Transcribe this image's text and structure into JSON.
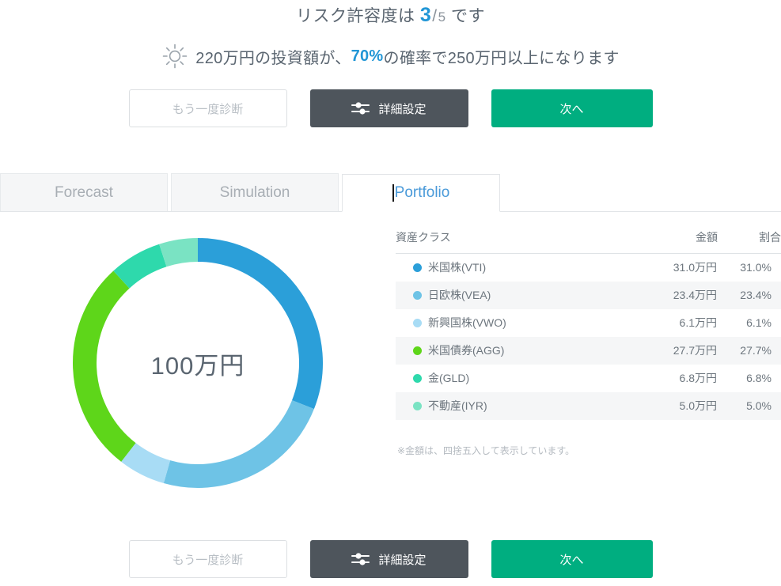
{
  "header": {
    "risk_prefix": "リスク許容度は",
    "risk_level": "3",
    "risk_slash": "/",
    "risk_max": "5",
    "risk_suffix": "です",
    "forecast_part1": "220万円の投資額が、",
    "forecast_probability": "70%",
    "forecast_part2": "の確率で250万円以上になります",
    "sun_icon": "sun-icon"
  },
  "actions": {
    "rediagnose_label": "もう一度診断",
    "settings_label": "詳細設定",
    "settings_icon": "sliders-icon",
    "next_label": "次へ"
  },
  "tabs": [
    {
      "label": "Forecast",
      "active": false
    },
    {
      "label": "Simulation",
      "active": false
    },
    {
      "label": "Portfolio",
      "active": true
    }
  ],
  "portfolio": {
    "center_total": "100万円",
    "note": "※金額は、四捨五入して表示しています。",
    "columns": {
      "asset_class": "資産クラス",
      "amount": "金額",
      "ratio": "割合"
    },
    "rows": [
      {
        "name": "米国株(VTI)",
        "amount": "31.0万円",
        "ratio": "31.0%",
        "color": "#2b9fd9"
      },
      {
        "name": "日欧株(VEA)",
        "amount": "23.4万円",
        "ratio": "23.4%",
        "color": "#6ec3e6"
      },
      {
        "name": "新興国株(VWO)",
        "amount": "6.1万円",
        "ratio": "6.1%",
        "color": "#a8dcf5"
      },
      {
        "name": "米国債券(AGG)",
        "amount": "27.7万円",
        "ratio": "27.7%",
        "color": "#5ed61a"
      },
      {
        "name": "金(GLD)",
        "amount": "6.8万円",
        "ratio": "6.8%",
        "color": "#2ed9ac"
      },
      {
        "name": "不動産(IYR)",
        "amount": "5.0万円",
        "ratio": "5.0%",
        "color": "#7ae3c3"
      }
    ]
  },
  "chart_data": {
    "type": "pie",
    "title": "Portfolio allocation",
    "center_label": "100万円",
    "unit": "%",
    "start_angle": 0,
    "donut_hole_ratio": 0.84,
    "categories": [
      "米国株(VTI)",
      "日欧株(VEA)",
      "新興国株(VWO)",
      "米国債券(AGG)",
      "金(GLD)",
      "不動産(IYR)"
    ],
    "values": [
      31.0,
      23.4,
      6.1,
      27.7,
      6.8,
      5.0
    ],
    "amounts": [
      "31.0万円",
      "23.4万円",
      "6.1万円",
      "27.7万円",
      "6.8万円",
      "5.0万円"
    ],
    "colors": [
      "#2b9fd9",
      "#6ec3e6",
      "#a8dcf5",
      "#5ed61a",
      "#2ed9ac",
      "#7ae3c3"
    ],
    "legend_position": "right-table",
    "grid": false
  },
  "theme": {
    "accent_blue": "#2196d6",
    "accent_green": "#00ae80",
    "dark_button": "#4e555c",
    "text_gray": "#5a6570"
  }
}
